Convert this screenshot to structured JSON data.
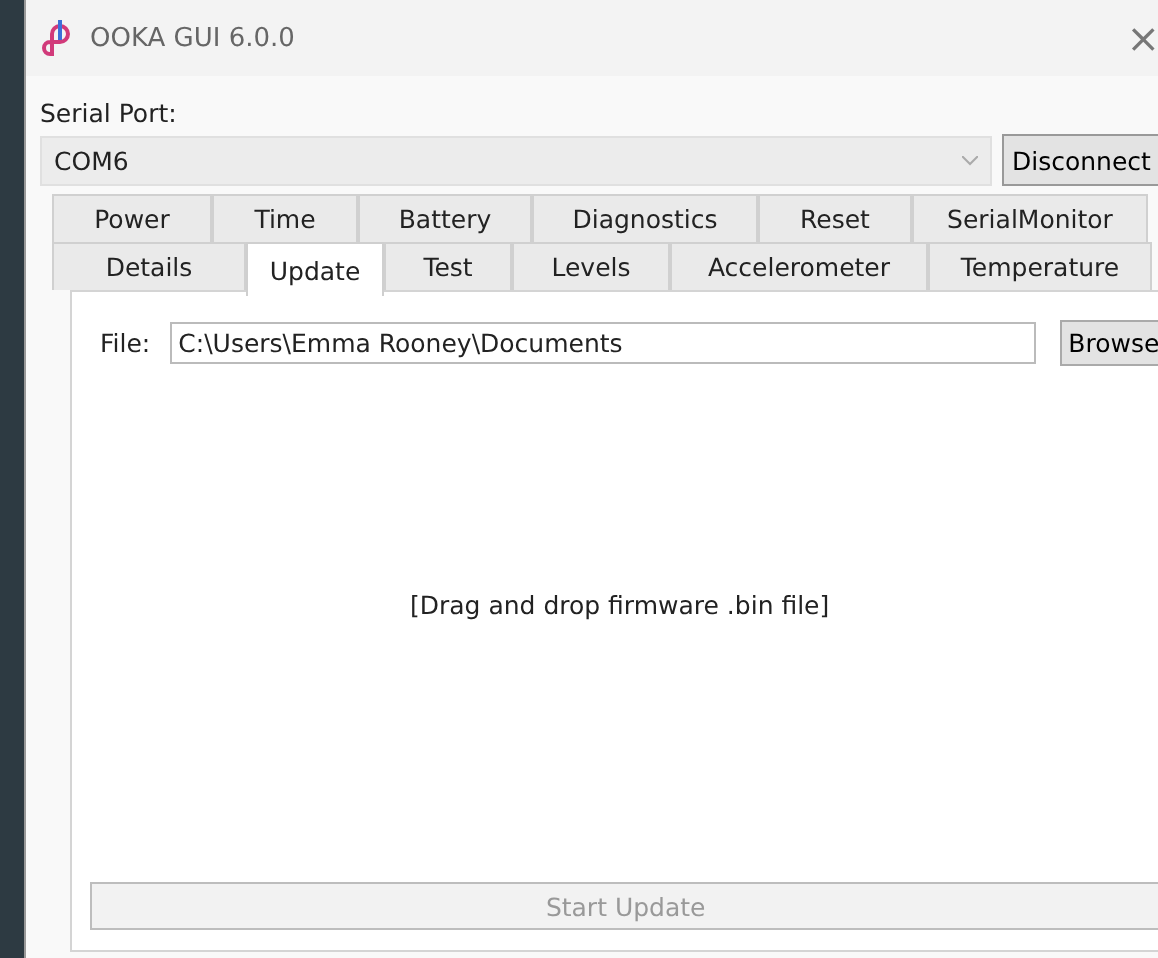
{
  "window": {
    "title": "OOKA GUI 6.0.0",
    "close": "×"
  },
  "serial_port": {
    "label": "Serial Port:",
    "value": "COM6",
    "button": "Disconnect"
  },
  "tab_rows": [
    [
      {
        "label": "Power",
        "selected": false
      },
      {
        "label": "Time",
        "selected": false
      },
      {
        "label": "Battery",
        "selected": false
      },
      {
        "label": "Diagnostics",
        "selected": false
      },
      {
        "label": "Reset",
        "selected": false
      },
      {
        "label": "SerialMonitor",
        "selected": false
      }
    ],
    [
      {
        "label": "Details",
        "selected": false
      },
      {
        "label": "Update",
        "selected": true
      },
      {
        "label": "Test",
        "selected": false
      },
      {
        "label": "Levels",
        "selected": false
      },
      {
        "label": "Accelerometer",
        "selected": false
      },
      {
        "label": "Temperature",
        "selected": false
      }
    ]
  ],
  "update": {
    "file_label": "File:",
    "file_value": "C:\\Users\\Emma Rooney\\Documents",
    "browse": "Browse",
    "drop_hint": "[Drag and drop firmware .bin file]",
    "start_button": {
      "label": "Start Update",
      "disabled": true
    }
  }
}
